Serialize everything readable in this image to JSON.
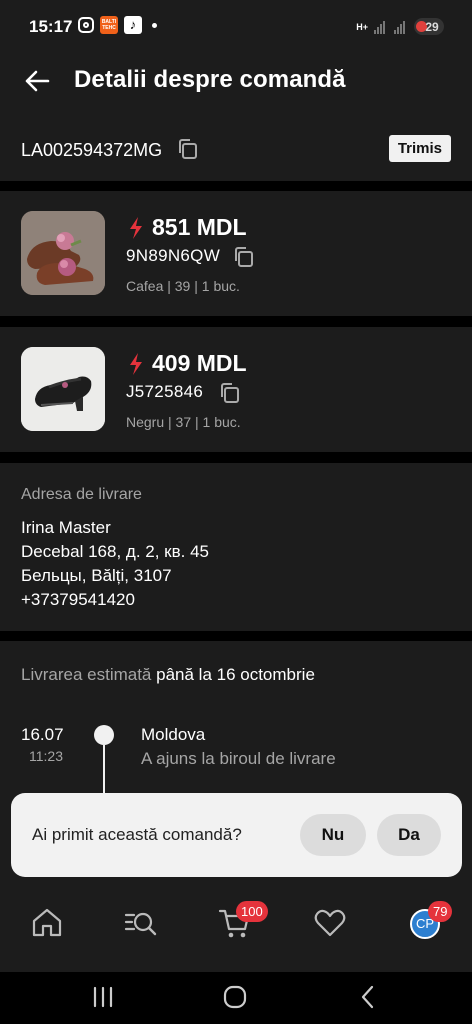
{
  "status_bar": {
    "time": "15:17",
    "orange_app_label": "BALTI TEHC",
    "tiktok_label": "♪",
    "network_label": "H+",
    "battery": "29"
  },
  "header": {
    "title": "Detalii despre comandă"
  },
  "order": {
    "id": "LA002594372MG",
    "status": "Trimis"
  },
  "products": [
    {
      "price": "851 MDL",
      "sku": "9N89N6QW",
      "variant": "Cafea | 39 | 1 buc."
    },
    {
      "price": "409 MDL",
      "sku": "J5725846",
      "variant": "Negru | 37 | 1 buc."
    }
  ],
  "address": {
    "label": "Adresa de livrare",
    "name": "Irina Master",
    "street": "Decebal 168, д. 2, кв. 45",
    "city": "Бельцы, Bălți, 3107",
    "phone": "+37379541420"
  },
  "delivery": {
    "estimate_label": "Livrarea estimată",
    "estimate_value": "până la 16 octombrie",
    "events": [
      {
        "date": "16.07",
        "time": "11:23",
        "place": "Moldova",
        "description": "A ajuns la biroul de livrare"
      }
    ]
  },
  "confirm": {
    "question": "Ai primit această comandă?",
    "no_label": "Nu",
    "yes_label": "Da"
  },
  "tabbar": {
    "cart_badge": "100",
    "profile_badge": "79",
    "avatar_initials": "CP"
  },
  "colors": {
    "background": "#000000",
    "card": "#1c1c1c",
    "accent_red": "#e5333c",
    "muted_text": "#a5a5a5"
  }
}
